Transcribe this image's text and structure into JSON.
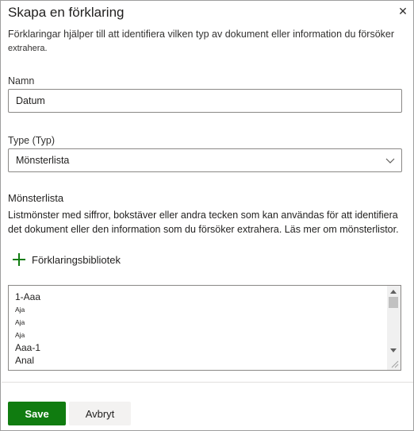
{
  "panel": {
    "title": "Skapa en förklaring",
    "close_icon": "close-icon",
    "description_main": "Förklaringar hjälper till att identifiera vilken typ av dokument eller information du försöker",
    "description_tail": "extrahera."
  },
  "name_field": {
    "label": "Namn",
    "value": "Datum"
  },
  "type_field": {
    "label": "Type (Typ)",
    "selected": "Mönsterlista",
    "icon": "chevron-down-icon"
  },
  "pattern_section": {
    "title": "Mönsterlista",
    "description": "Listmönster med siffror, bokstäver eller andra tecken som kan användas för att identifiera det dokument eller den information som du försöker extrahera. Läs mer om mönsterlistor.",
    "add_button_label": "Förklaringsbibliotek",
    "add_icon": "plus-icon",
    "items": [
      "1-Aaa",
      "Aja",
      "Aja",
      "Aja",
      "Aaa-1",
      "Anal"
    ]
  },
  "footer": {
    "save_label": "Save",
    "cancel_label": "Avbryt",
    "accent_color": "#107c10"
  }
}
